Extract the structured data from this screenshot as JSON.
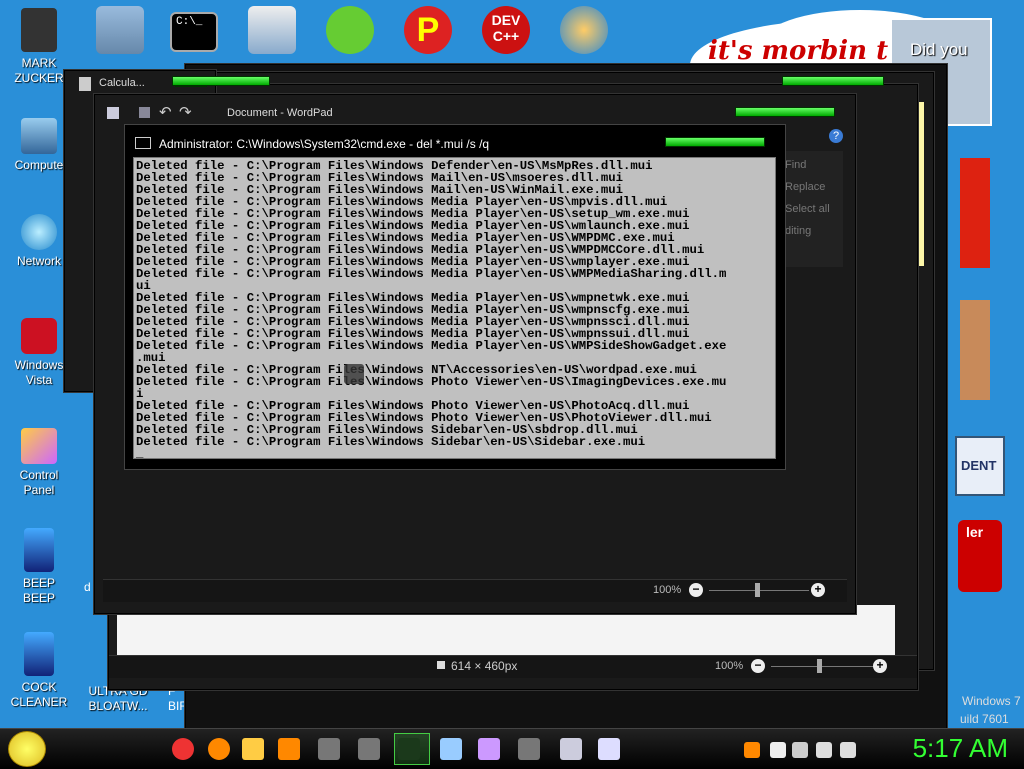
{
  "desktop": {
    "icons": [
      {
        "label": "MARK\nZUCKER",
        "icon": "person-icon"
      },
      {
        "label": "Compute",
        "icon": "computer-icon"
      },
      {
        "label": "Network",
        "icon": "network-icon"
      },
      {
        "label": "Windows\nVista",
        "icon": "trash-icon"
      },
      {
        "label": "Control\nPanel",
        "icon": "control-panel-icon"
      },
      {
        "label": "BEEP\nBEEP",
        "icon": "app-icon"
      },
      {
        "label": "COCK\nCLEANER",
        "icon": "app-icon"
      },
      {
        "label": "ULTRA GD\nBLOATW...",
        "icon": "app-icon"
      }
    ],
    "top_icons": [
      {
        "icon": "folder-icon"
      },
      {
        "icon": "notepad-icon"
      },
      {
        "icon": "cmd-icon"
      },
      {
        "icon": "stack-icon"
      },
      {
        "icon": "angry-pig-icon"
      },
      {
        "icon": "p-icon"
      },
      {
        "icon": "devcpp-icon",
        "text": "DEV\nC++"
      },
      {
        "icon": "globe-icon"
      }
    ],
    "wallpaper_text": "it's morbin t",
    "did_you_text": "Did you",
    "partial_labels": {
      "dent": "DENT",
      "ler": "ler",
      "win7": "Windows 7",
      "build": "uild 7601",
      "d": "d",
      "fbir": "F\nBIR"
    }
  },
  "calculator": {
    "title": "Calcula..."
  },
  "wordpad": {
    "title": "Document - WordPad",
    "ribbon_items": [
      "Find",
      "Replace",
      "Select all",
      "diting"
    ],
    "zoom": "100%"
  },
  "paint": {
    "dimensions": "614 × 460px",
    "zoom": "100%"
  },
  "cmd": {
    "title": "Administrator: C:\\Windows\\System32\\cmd.exe - del  *.mui /s /q",
    "lines": [
      "Deleted file - C:\\Program Files\\Windows Defender\\en-US\\MsMpRes.dll.mui",
      "Deleted file - C:\\Program Files\\Windows Mail\\en-US\\msoeres.dll.mui",
      "Deleted file - C:\\Program Files\\Windows Mail\\en-US\\WinMail.exe.mui",
      "Deleted file - C:\\Program Files\\Windows Media Player\\en-US\\mpvis.dll.mui",
      "Deleted file - C:\\Program Files\\Windows Media Player\\en-US\\setup_wm.exe.mui",
      "Deleted file - C:\\Program Files\\Windows Media Player\\en-US\\wmlaunch.exe.mui",
      "Deleted file - C:\\Program Files\\Windows Media Player\\en-US\\WMPDMC.exe.mui",
      "Deleted file - C:\\Program Files\\Windows Media Player\\en-US\\WMPDMCCore.dll.mui",
      "Deleted file - C:\\Program Files\\Windows Media Player\\en-US\\wmplayer.exe.mui",
      "Deleted file - C:\\Program Files\\Windows Media Player\\en-US\\WMPMediaSharing.dll.m",
      "ui",
      "Deleted file - C:\\Program Files\\Windows Media Player\\en-US\\wmpnetwk.exe.mui",
      "Deleted file - C:\\Program Files\\Windows Media Player\\en-US\\wmpnscfg.exe.mui",
      "Deleted file - C:\\Program Files\\Windows Media Player\\en-US\\wmpnssci.dll.mui",
      "Deleted file - C:\\Program Files\\Windows Media Player\\en-US\\wmpnssui.dll.mui",
      "Deleted file - C:\\Program Files\\Windows Media Player\\en-US\\WMPSideShowGadget.exe",
      ".mui",
      "Deleted file - C:\\Program Files\\Windows NT\\Accessories\\en-US\\wordpad.exe.mui",
      "Deleted file - C:\\Program Files\\Windows Photo Viewer\\en-US\\ImagingDevices.exe.mu",
      "i",
      "Deleted file - C:\\Program Files\\Windows Photo Viewer\\en-US\\PhotoAcq.dll.mui",
      "Deleted file - C:\\Program Files\\Windows Photo Viewer\\en-US\\PhotoViewer.dll.mui",
      "Deleted file - C:\\Program Files\\Windows Sidebar\\en-US\\sbdrop.dll.mui",
      "Deleted file - C:\\Program Files\\Windows Sidebar\\en-US\\Sidebar.exe.mui",
      "_"
    ]
  },
  "taskbar": {
    "clock": "5:17 AM",
    "apps": [
      "smiley-start-icon",
      "chrome-icon",
      "firefox-icon",
      "folder-icon",
      "search-icon",
      "app-icon",
      "app-icon",
      "cmd-icon",
      "notepad-icon",
      "paint-icon",
      "app-icon",
      "calculator-icon",
      "wordpad-icon"
    ],
    "tray": [
      "search-icon",
      "flag-icon",
      "action-center-icon",
      "network-icon",
      "volume-icon"
    ]
  }
}
